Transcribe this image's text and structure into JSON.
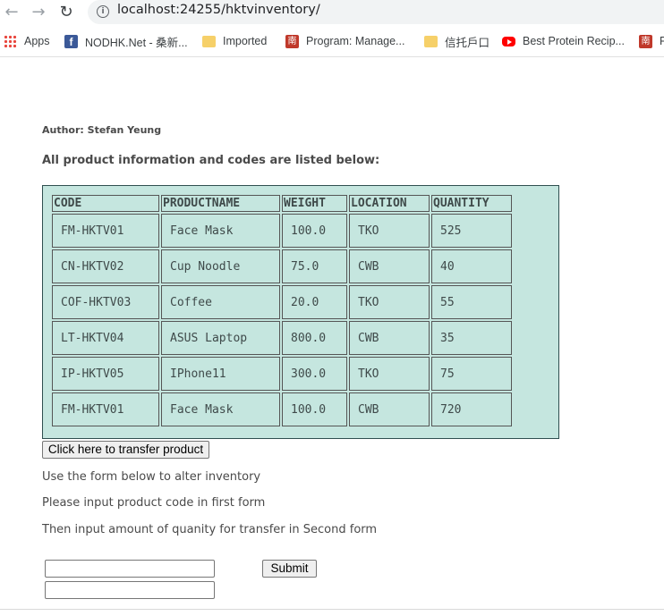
{
  "browser": {
    "url": "localhost:24255/hktvinventory/",
    "bookmarks": [
      {
        "label": "Apps",
        "icon": "apps-grid-icon"
      },
      {
        "label": "NODHK.Net - 桑新...",
        "icon": "facebook-icon"
      },
      {
        "label": "Imported",
        "icon": "folder-icon"
      },
      {
        "label": "Program: Manage...",
        "icon": "program-icon"
      },
      {
        "label": "信托戶口",
        "icon": "folder-icon"
      },
      {
        "label": "Best Protein Recip...",
        "icon": "youtube-icon"
      },
      {
        "label": "F",
        "icon": "program-icon"
      }
    ]
  },
  "page": {
    "author": "Author: Stefan Yeung",
    "intro": "All product information and codes are listed below:",
    "table": {
      "headers": [
        "CODE",
        "PRODUCTNAME",
        "WEIGHT",
        "LOCATION",
        "QUANTITY"
      ],
      "rows": [
        [
          "FM-HKTV01",
          "Face Mask",
          "100.0",
          "TKO",
          "525"
        ],
        [
          "CN-HKTV02",
          "Cup Noodle",
          "75.0",
          "CWB",
          "40"
        ],
        [
          "COF-HKTV03",
          "Coffee",
          "20.0",
          "TKO",
          "55"
        ],
        [
          "LT-HKTV04",
          "ASUS Laptop",
          "800.0",
          "CWB",
          "35"
        ],
        [
          "IP-HKTV05",
          "IPhone11",
          "300.0",
          "TKO",
          "75"
        ],
        [
          "FM-HKTV01",
          "Face Mask",
          "100.0",
          "CWB",
          "720"
        ]
      ]
    },
    "transfer_button": "Click here to transfer product",
    "notes": [
      "Use the form below to alter inventory",
      "Please input product code in first form",
      "Then input amount of quanity for transfer in Second form"
    ],
    "form": {
      "code_value": "",
      "amount_value": "",
      "submit_label": "Submit"
    }
  },
  "colors": {
    "table_bg": "#c5e6df",
    "table_border": "#2f4f4f",
    "text": "#4a4a4a"
  }
}
